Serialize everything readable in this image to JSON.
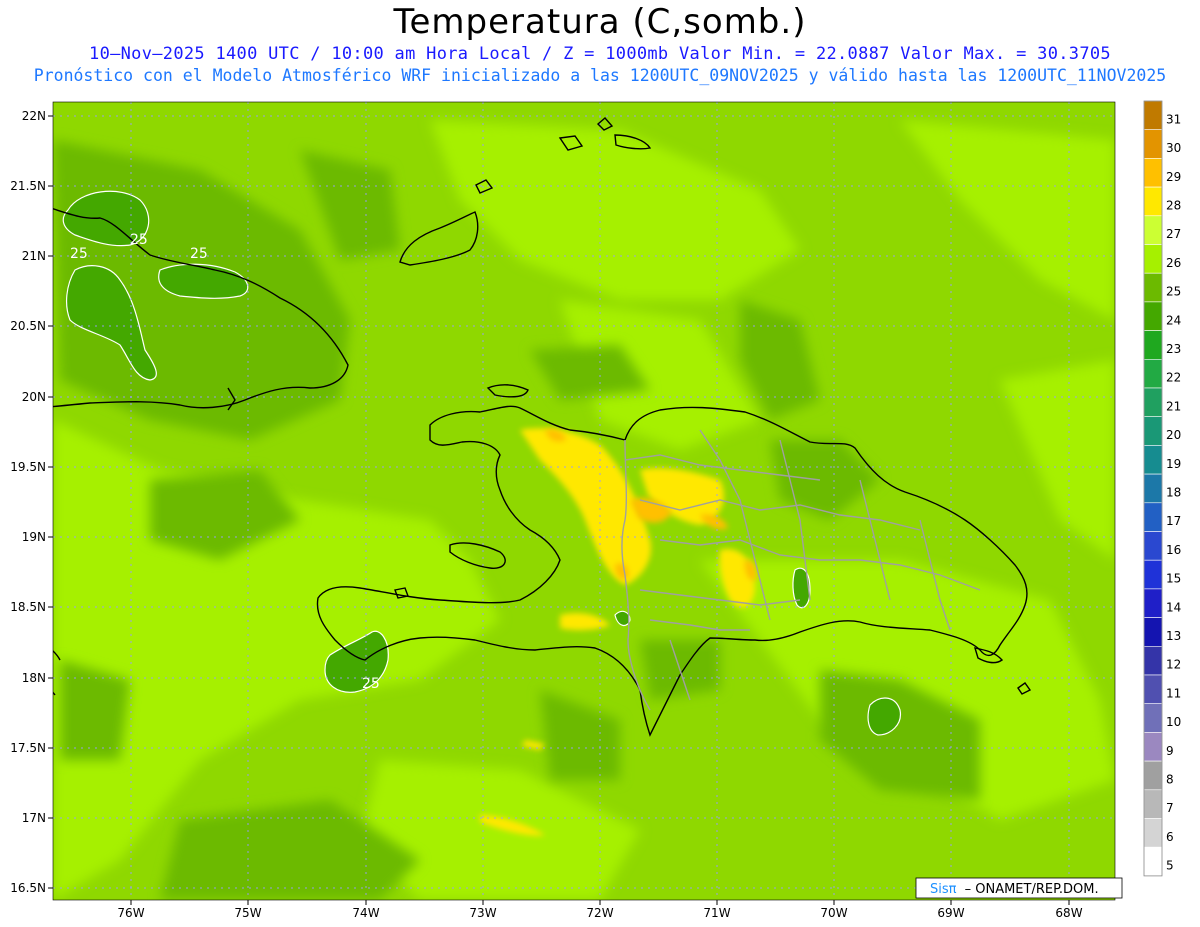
{
  "header": {
    "title": "Temperatura (C,somb.)",
    "subtitle_line1": "10–Nov–2025 1400 UTC / 10:00 am Hora Local / Z = 1000mb  Valor Min. = 22.0887  Valor Max. = 30.3705",
    "subtitle_line2": "Pronóstico con el Modelo Atmosférico WRF inicializado a las 1200UTC_09NOV2025 y válido hasta las  1200UTC_11NOV2025"
  },
  "map": {
    "lat_labels": [
      "22N",
      "21.5N",
      "21N",
      "20.5N",
      "20N",
      "19.5N",
      "19N",
      "18.5N",
      "18N",
      "17.5N",
      "17N",
      "16.5N"
    ],
    "lon_labels": [
      "76W",
      "75W",
      "74W",
      "73W",
      "72W",
      "71W",
      "70W",
      "69W",
      "68W"
    ],
    "contour_labels": [
      "25",
      "25",
      "25",
      "25"
    ],
    "credit_prefix": "Sisπ",
    "credit_suffix": "– ONAMET/REP.DOM."
  },
  "legend": {
    "labels": [
      "31",
      "30",
      "29",
      "28",
      "27",
      "26",
      "25",
      "24",
      "23",
      "22",
      "21",
      "20",
      "19",
      "18",
      "17",
      "16",
      "15",
      "14",
      "13",
      "12",
      "11",
      "10",
      "9",
      "8",
      "7",
      "6",
      "5"
    ],
    "colors": [
      "#c07a00",
      "#e39400",
      "#ffc000",
      "#ffe800",
      "#ccff33",
      "#a6f000",
      "#6cba00",
      "#44a800",
      "#1fa81f",
      "#22aa44",
      "#20a060",
      "#1a9876",
      "#168c90",
      "#1c78a8",
      "#2260c4",
      "#2a48d0",
      "#1f32d8",
      "#1f1fc8",
      "#1414b0",
      "#3434a8",
      "#5050b0",
      "#7070b8",
      "#9b88c0",
      "#a0a0a0",
      "#b8b8b8",
      "#d4d4d4",
      "#ffffff"
    ]
  }
}
